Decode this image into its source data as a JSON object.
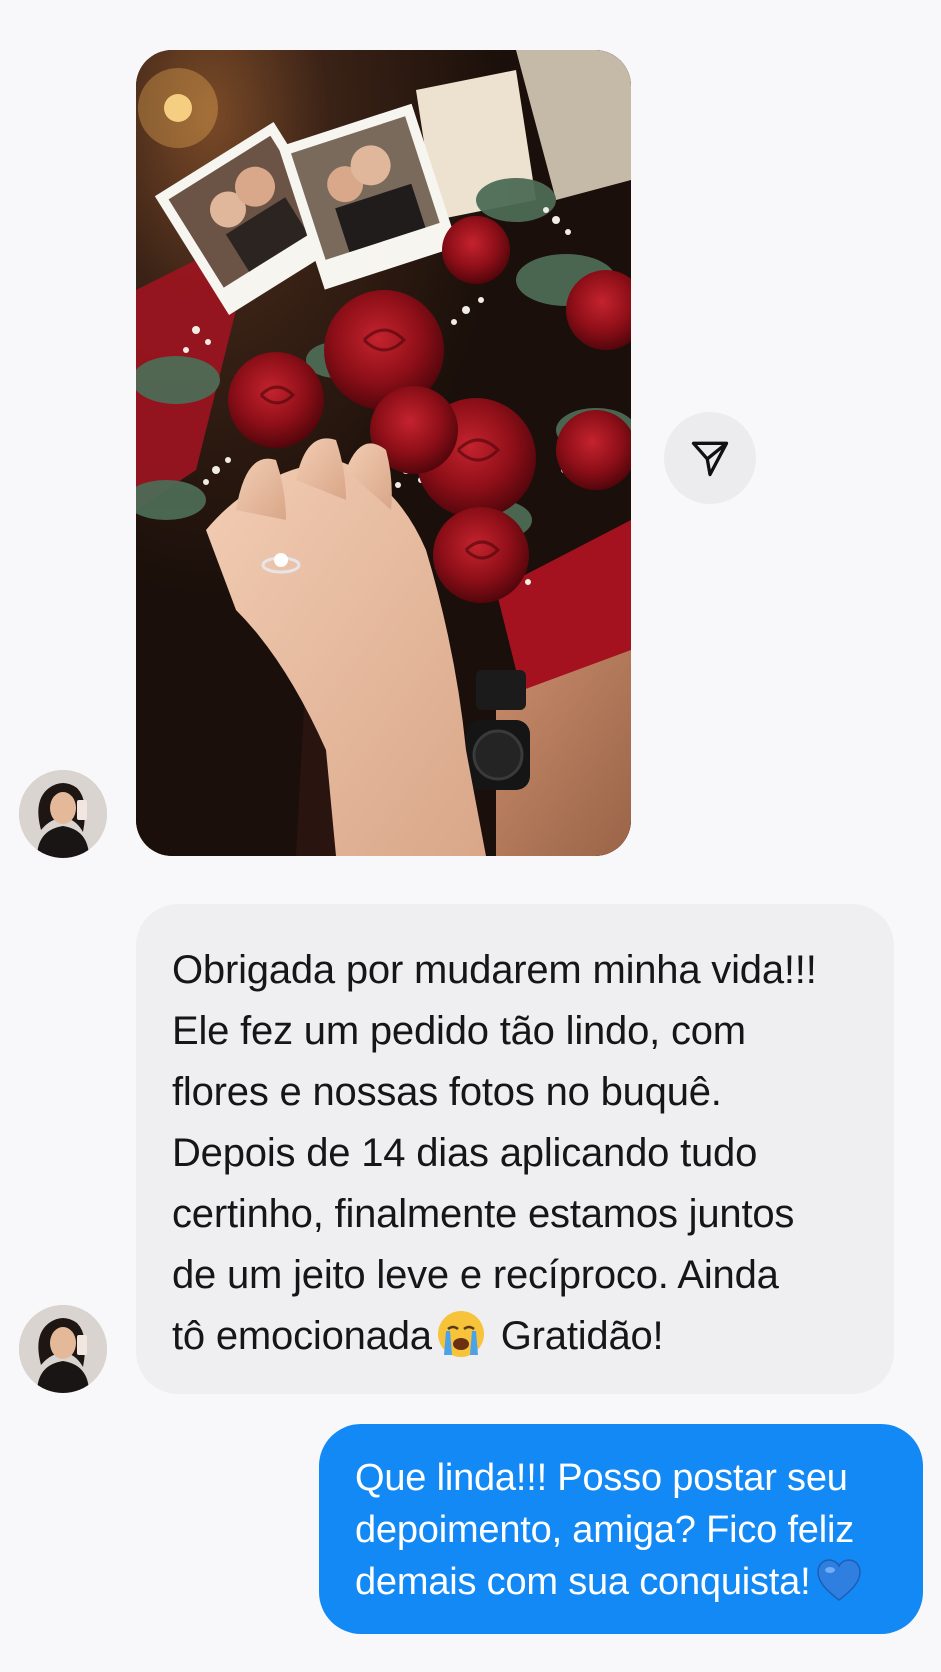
{
  "conversation": {
    "photo_message": {
      "alt": "Mãos com anel de noivado sobre buquê de rosas vermelhas com fotos do casal"
    },
    "share_button": {
      "icon": "paper-plane-icon"
    },
    "contact_avatar": {
      "icon": "avatar"
    },
    "incoming_message": {
      "line_1": "Obrigada por mudarem minha vida!!!",
      "line_2": "Ele fez um pedido tão lindo, com",
      "line_3": "flores e nossas fotos no buquê.",
      "line_4": "Depois de 14 dias aplicando tudo",
      "line_5": "certinho, finalmente estamos juntos",
      "line_6": "de um jeito leve e recíproco. Ainda",
      "line_7_start": "tô emocionada",
      "emoji": "loudly-crying-face-icon",
      "line_7_end": "Gratidão!"
    },
    "outgoing_message": {
      "line_1": "Que linda!!! Posso postar seu",
      "line_2": "depoimento, amiga? Fico feliz",
      "line_3": "demais com sua conquista!",
      "emoji": "blue-heart-icon"
    }
  },
  "colors": {
    "background": "#f8f8fa",
    "incoming_bubble": "#efeff2",
    "outgoing_bubble": "#1289f5",
    "share_button_bg": "#ececef"
  }
}
